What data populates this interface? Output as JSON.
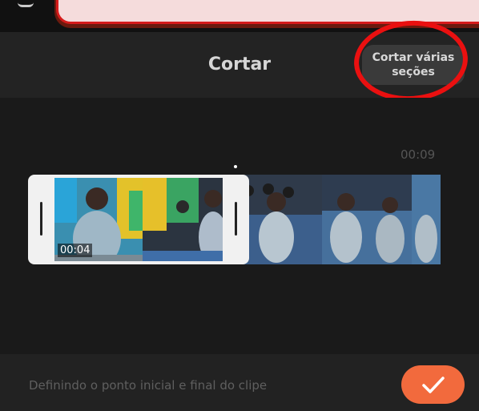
{
  "header": {
    "title": "Cortar",
    "multi_section_button": {
      "line1": "Cortar várias",
      "line2": "seções"
    }
  },
  "timeline": {
    "end_time": "00:09",
    "clip_time": "00:04"
  },
  "footer": {
    "status": "Definindo o ponto inicial e final do clipe",
    "confirm_icon": "checkmark-icon"
  },
  "colors": {
    "accent": "#f26a3d",
    "highlight_ring": "#ea1010"
  }
}
